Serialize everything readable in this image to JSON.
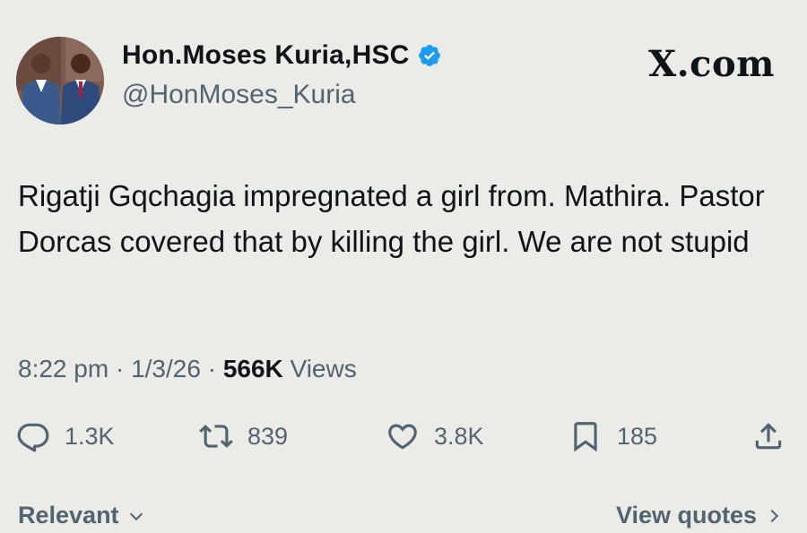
{
  "author": {
    "display_name": "Hon.Moses Kuria,HSC",
    "handle": "@HonMoses_Kuria",
    "verified_icon": "verified-badge-icon",
    "accent_color": "#1d9bf0"
  },
  "brand": {
    "label": "X.com"
  },
  "tweet": {
    "text": "Rigatji Gqchagia impregnated a girl from. Mathira. Pastor Dorcas covered that by killing the girl. We are not stupid"
  },
  "meta": {
    "time": "8:22 pm",
    "separator": "·",
    "date": "1/3/26",
    "views_count": "566K",
    "views_label": "Views"
  },
  "actions": {
    "replies": {
      "icon": "reply-icon",
      "count": "1.3K"
    },
    "reposts": {
      "icon": "repost-icon",
      "count": "839"
    },
    "likes": {
      "icon": "heart-icon",
      "count": "3.8K"
    },
    "bookmarks": {
      "icon": "bookmark-icon",
      "count": "185"
    },
    "share": {
      "icon": "share-icon"
    }
  },
  "footer": {
    "sort_label": "Relevant",
    "quotes_label": "View quotes"
  }
}
